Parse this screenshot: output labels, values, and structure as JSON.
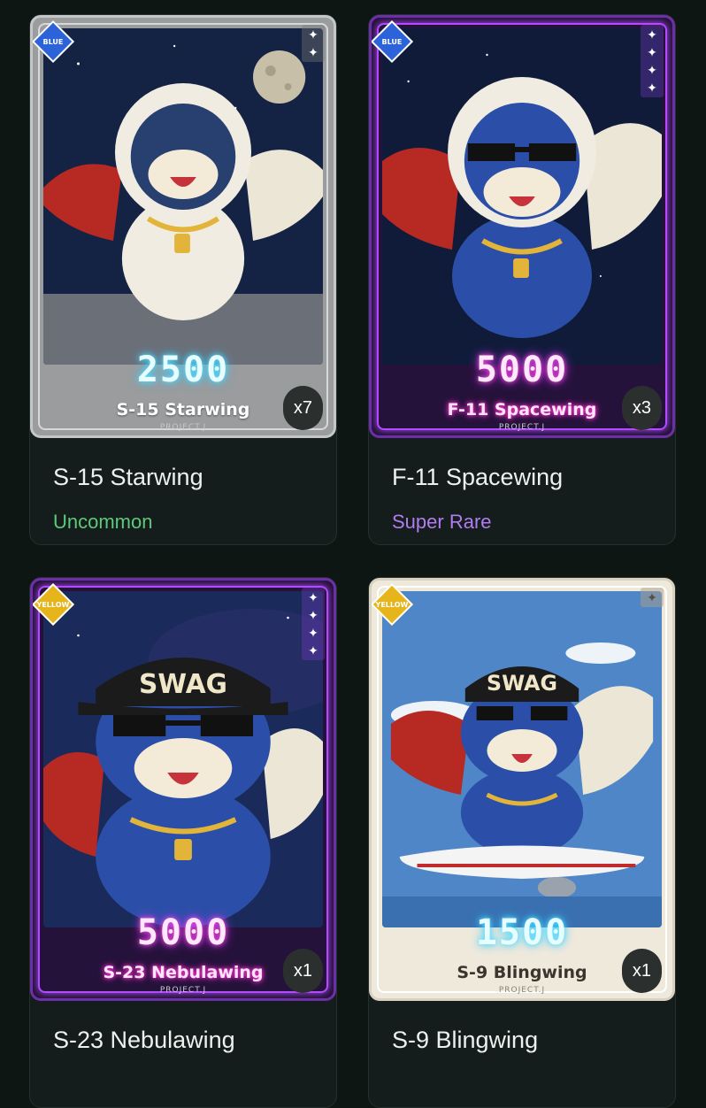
{
  "cards": [
    {
      "title": "S-15 Starwing",
      "rarity": "Uncommon",
      "rarity_color": "#5ec97a",
      "tier_badge": "BLUE",
      "card_points": "2500",
      "card_name": "S-15 Starwing",
      "brand": "PROJECT.J",
      "quantity": "x7",
      "frame": "silver",
      "stars": 2
    },
    {
      "title": "F-11 Spacewing",
      "rarity": "Super Rare",
      "rarity_color": "#b07cf0",
      "tier_badge": "BLUE",
      "card_points": "5000",
      "card_name": "F-11 Spacewing",
      "brand": "PROJECT.J",
      "quantity": "x3",
      "frame": "purple",
      "stars": 4
    },
    {
      "title": "S-23 Nebulawing",
      "tier_badge": "YELLOW",
      "card_points": "5000",
      "card_name": "S-23 Nebulawing",
      "brand": "PROJECT.J",
      "quantity": "x1",
      "frame": "purple",
      "stars": 4
    },
    {
      "title": "S-9 Blingwing",
      "tier_badge": "YELLOW",
      "card_points": "1500",
      "card_name": "S-9 Blingwing",
      "brand": "PROJECT.J",
      "quantity": "x1",
      "frame": "cream",
      "stars": 1
    }
  ]
}
